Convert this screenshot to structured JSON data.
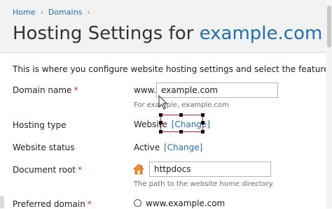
{
  "breadcrumb": {
    "items": [
      "Home",
      "Domains"
    ],
    "separator": "›"
  },
  "page_title": {
    "prefix": "Hosting Settings for ",
    "domain": "example.com"
  },
  "intro_text": "This is where you configure website hosting settings and select the features available fo",
  "form": {
    "domain_name": {
      "label": "Domain name",
      "required_mark": "*",
      "prefix": "www.",
      "value": "example.com",
      "hint": "For example, example.com"
    },
    "hosting_type": {
      "label": "Hosting type",
      "value": "Website",
      "change_link": "[Change]"
    },
    "website_status": {
      "label": "Website status",
      "value": "Active",
      "change_link": "[Change]"
    },
    "document_root": {
      "label": "Document root",
      "required_mark": "*",
      "value": "httpdocs",
      "hint": "The path to the website home directory.",
      "icon": "home-folder-icon"
    },
    "preferred_domain": {
      "label": "Preferred domain",
      "required_mark": "*",
      "option_label": "www.example.com",
      "selected": false
    }
  },
  "colors": {
    "link": "#1f6fb2",
    "required": "#d02c2c",
    "annotation": "#d81e1e",
    "header_bg": "#f2f2f2"
  }
}
